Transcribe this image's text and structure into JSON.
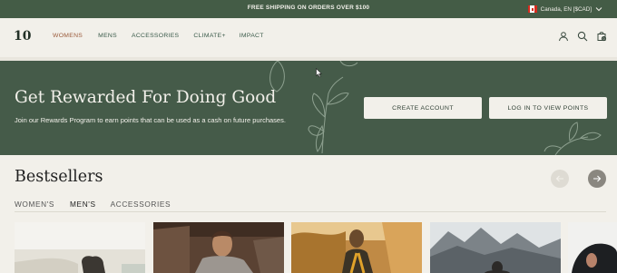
{
  "topbar": {
    "promo": "FREE SHIPPING ON ORDERS OVER $100",
    "locale": "Canada, EN [$CAD]"
  },
  "header": {
    "logo": "10",
    "nav": [
      "WOMENS",
      "MENS",
      "ACCESSORIES",
      "CLIMATE+",
      "IMPACT"
    ],
    "icons": [
      "account-icon",
      "search-icon",
      "cart-icon"
    ],
    "cart_count": "0"
  },
  "banner": {
    "title": "Get Rewarded For Doing Good",
    "subtitle": "Join our Rewards Program to earn points that can be used as a cash on future purchases.",
    "create_account": "CREATE ACCOUNT",
    "log_in": "LOG IN TO VIEW POINTS"
  },
  "bestsellers": {
    "title": "Bestsellers",
    "tabs": [
      "WOMEN'S",
      "MEN'S",
      "ACCESSORIES"
    ],
    "active_tab": "MEN'S"
  },
  "colors": {
    "brand_green": "#455b49",
    "cream": "#f2f0ea"
  }
}
